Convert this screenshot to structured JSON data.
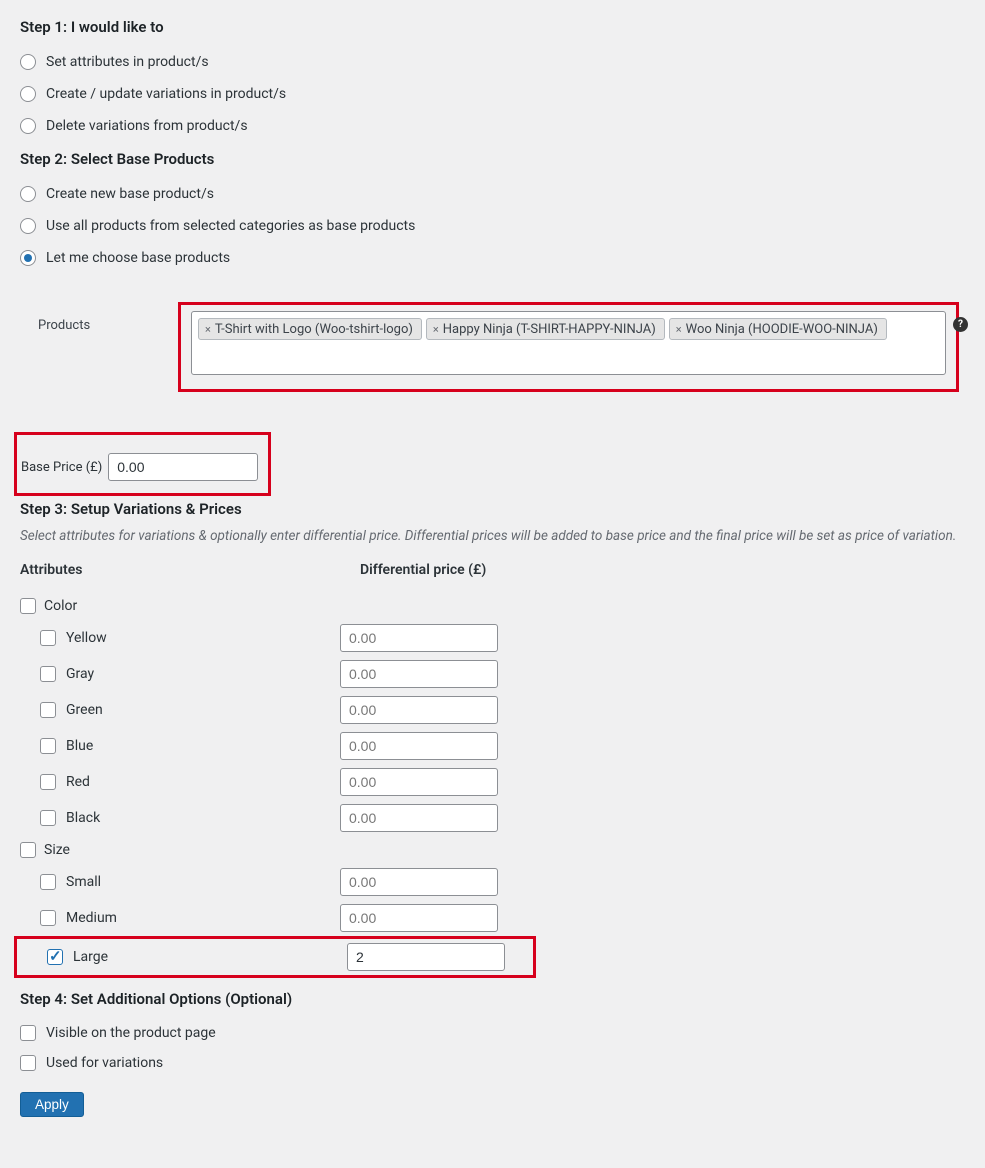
{
  "step1": {
    "title": "Step 1: I would like to",
    "options": {
      "set": "Set attributes in product/s",
      "create": "Create / update variations in product/s",
      "delete": "Delete variations from product/s"
    }
  },
  "step2": {
    "title": "Step 2: Select Base Products",
    "options": {
      "new": "Create new base product/s",
      "all": "Use all products from selected categories as base products",
      "choose": "Let me choose base products"
    },
    "products_label": "Products",
    "tags": [
      "T-Shirt with Logo (Woo-tshirt-logo)",
      "Happy Ninja (T-SHIRT-HAPPY-NINJA)",
      "Woo Ninja (HOODIE-WOO-NINJA)"
    ],
    "help_glyph": "?"
  },
  "base_price": {
    "label": "Base Price (£)",
    "value": "0.00"
  },
  "step3": {
    "title": "Step 3: Setup Variations & Prices",
    "subtext": "Select attributes for variations & optionally enter differential price. Differential prices will be added to base price and the final price will be set as price of variation.",
    "col_attr": "Attributes",
    "col_price": "Differential price (£)",
    "groups": {
      "color": {
        "label": "Color",
        "options": {
          "yellow": {
            "label": "Yellow",
            "price": "0.00"
          },
          "gray": {
            "label": "Gray",
            "price": "0.00"
          },
          "green": {
            "label": "Green",
            "price": "0.00"
          },
          "blue": {
            "label": "Blue",
            "price": "0.00"
          },
          "red": {
            "label": "Red",
            "price": "0.00"
          },
          "black": {
            "label": "Black",
            "price": "0.00"
          }
        }
      },
      "size": {
        "label": "Size",
        "options": {
          "small": {
            "label": "Small",
            "price": "0.00"
          },
          "medium": {
            "label": "Medium",
            "price": "0.00"
          },
          "large": {
            "label": "Large",
            "price": "2"
          }
        }
      }
    }
  },
  "step4": {
    "title": "Step 4: Set Additional Options (Optional)",
    "visible": "Visible on the product page",
    "used": "Used for variations"
  },
  "apply": "Apply"
}
